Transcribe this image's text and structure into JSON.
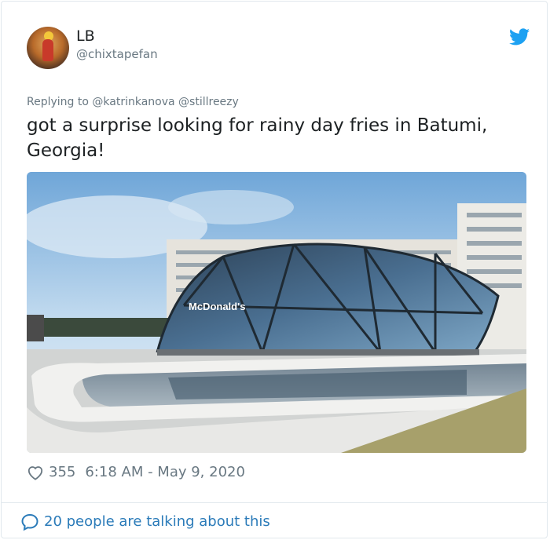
{
  "tweet": {
    "author": {
      "display_name": "LB",
      "handle": "@chixtapefan",
      "avatar_icon": "avatar-photo"
    },
    "brand_icon": "twitter-bird-icon",
    "reply": {
      "prefix": "Replying to",
      "mentions": [
        "@katrinkanova",
        "@stillreezy"
      ]
    },
    "text_line1": "got a surprise looking for rainy day fries in Batumi,",
    "text_line2": "Georgia!",
    "photo": {
      "description_icon": "photo-glass-mcdonalds",
      "sign_text": "McDonald's"
    },
    "likes": "355",
    "timestamp": "6:18 AM - May 9, 2020",
    "footer_text": "20 people are talking about this",
    "colors": {
      "brand": "#1da1f2",
      "link": "#2b7bb9",
      "muted": "#697882",
      "text": "#1c2022",
      "border": "#e1e8ed"
    }
  }
}
